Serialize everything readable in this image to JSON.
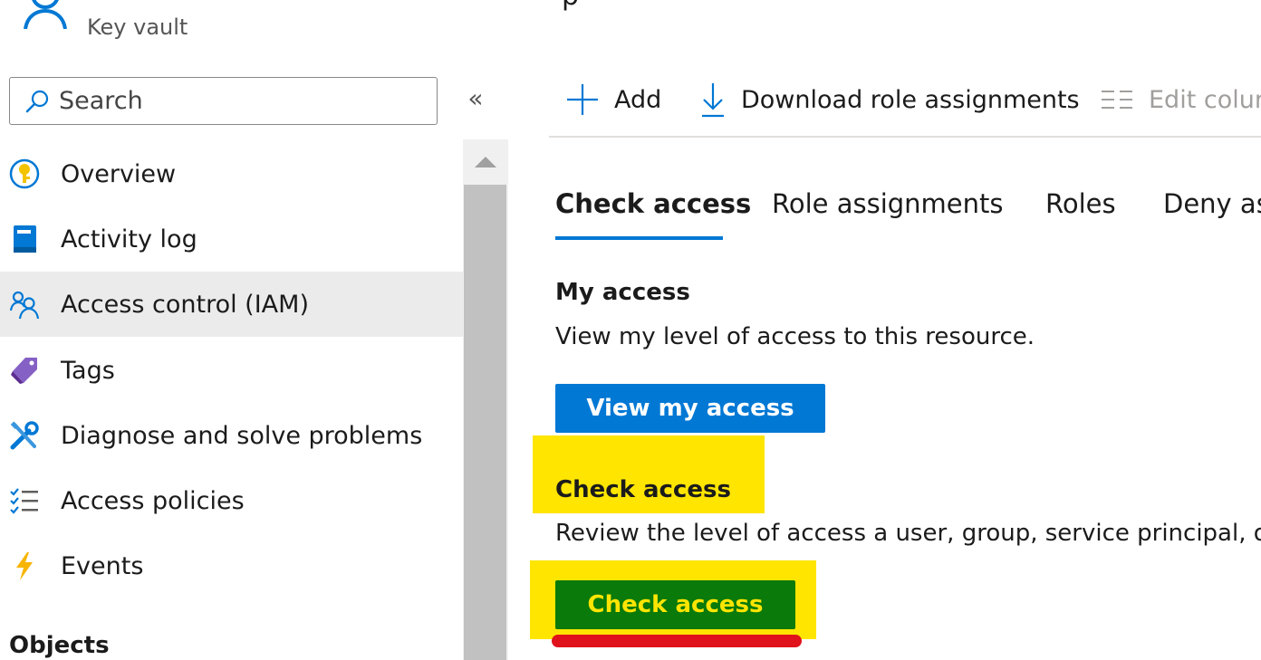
{
  "header": {
    "resource_type": "Key vault",
    "title_fragment": "p"
  },
  "sidebar": {
    "search_placeholder": "Search",
    "collapse_glyph": "«",
    "items": [
      {
        "label": "Overview",
        "icon": "key-circle-icon",
        "selected": false
      },
      {
        "label": "Activity log",
        "icon": "log-book-icon",
        "selected": false
      },
      {
        "label": "Access control (IAM)",
        "icon": "people-icon",
        "selected": true
      },
      {
        "label": "Tags",
        "icon": "tag-icon",
        "selected": false
      },
      {
        "label": "Diagnose and solve problems",
        "icon": "wrench-icon",
        "selected": false
      },
      {
        "label": "Access policies",
        "icon": "checklist-icon",
        "selected": false
      },
      {
        "label": "Events",
        "icon": "lightning-icon",
        "selected": false
      }
    ],
    "section_objects": "Objects"
  },
  "toolbar": {
    "add_label": "Add",
    "download_label": "Download role assignments",
    "edit_columns_label": "Edit colun"
  },
  "tabs": [
    "Check access",
    "Role assignments",
    "Roles",
    "Deny as"
  ],
  "my_access": {
    "heading": "My access",
    "description": "View my level of access to this resource.",
    "button_label": "View my access"
  },
  "check_access": {
    "heading": "Check access",
    "description": "Review the level of access a user, group, service principal, or",
    "button_label": "Check access"
  },
  "colors": {
    "accent": "#0078d4",
    "highlight": "#ffe500",
    "check_button": "#0a7a0a",
    "annotation_red": "#e0121b"
  }
}
